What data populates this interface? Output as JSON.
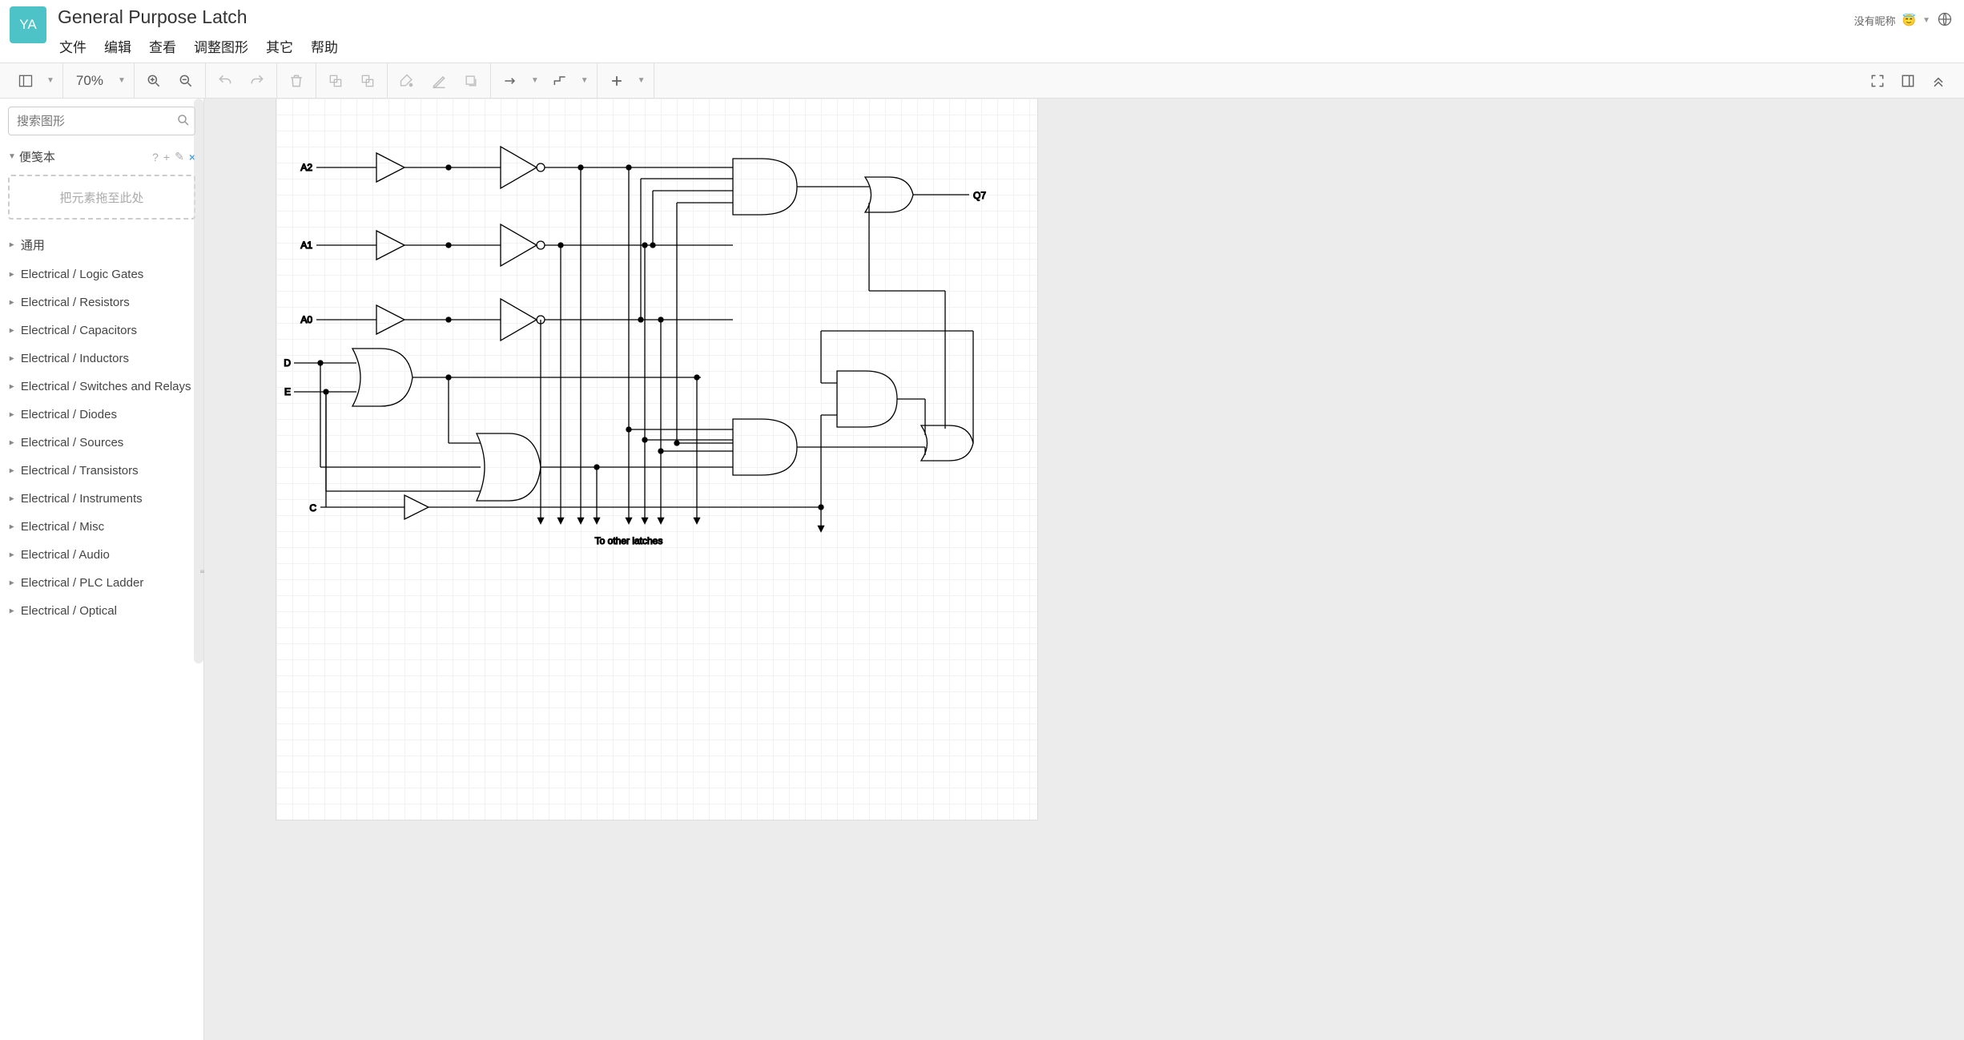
{
  "header": {
    "avatar_initials": "YA",
    "title": "General Purpose Latch",
    "user_label": "没有昵称",
    "user_emoji": "😇"
  },
  "menu": {
    "file": "文件",
    "edit": "编辑",
    "view": "查看",
    "adjust": "调整图形",
    "other": "其它",
    "help": "帮助"
  },
  "toolbar": {
    "zoom": "70%"
  },
  "sidebar": {
    "search_placeholder": "搜索图形",
    "scratchpad_title": "便笺本",
    "scratchpad_help": "?",
    "scratchpad_hint": "把元素拖至此处",
    "categories": [
      "通用",
      "Electrical / Logic Gates",
      "Electrical / Resistors",
      "Electrical / Capacitors",
      "Electrical / Inductors",
      "Electrical / Switches and Relays",
      "Electrical / Diodes",
      "Electrical / Sources",
      "Electrical / Transistors",
      "Electrical / Instruments",
      "Electrical / Misc",
      "Electrical / Audio",
      "Electrical / PLC Ladder",
      "Electrical / Optical"
    ]
  },
  "diagram": {
    "labels": {
      "a2": "A2",
      "a1": "A1",
      "a0": "A0",
      "d": "D",
      "e": "E",
      "c": "C",
      "q7": "Q7",
      "note": "To other latches"
    }
  }
}
